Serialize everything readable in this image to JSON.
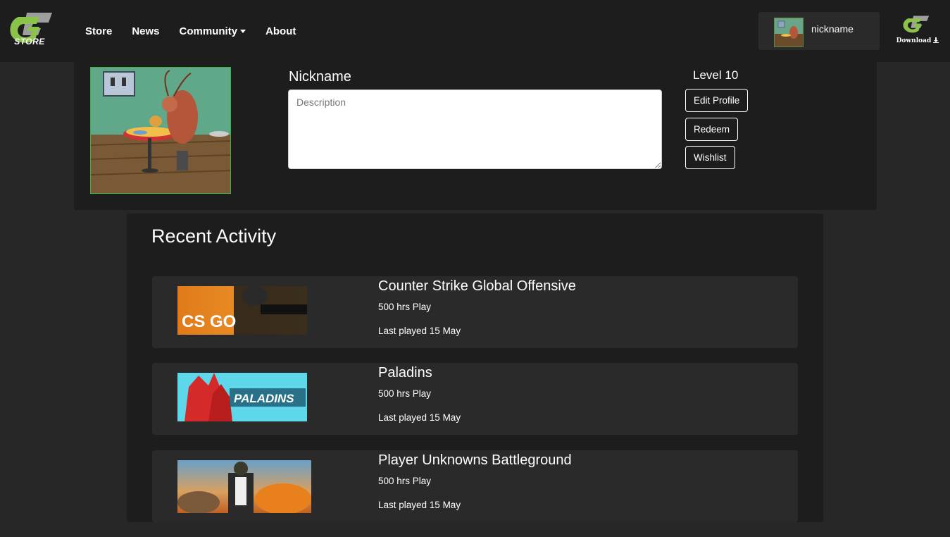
{
  "brand": {
    "logo_text": "STORE",
    "accent_color": "#8bc34a"
  },
  "nav": {
    "links": [
      "Store",
      "News",
      "Community",
      "About"
    ]
  },
  "user": {
    "nickname": "nickname"
  },
  "download": {
    "label": "Download",
    "icon": "download-icon"
  },
  "profile": {
    "name": "Nickname",
    "description_placeholder": "Description",
    "level": "Level 10",
    "buttons": {
      "edit": "Edit Profile",
      "redeem": "Redeem",
      "wishlist": "Wishlist"
    }
  },
  "activity": {
    "title": "Recent Activity",
    "games": [
      {
        "name": "Counter Strike Global Offensive",
        "hours": "500 hrs Play",
        "last_played": "Last played 15 May",
        "banner_text": "CS GO"
      },
      {
        "name": "Paladins",
        "hours": "500 hrs Play",
        "last_played": "Last played 15 May",
        "banner_text": "PALADINS"
      },
      {
        "name": "Player Unknowns Battleground",
        "hours": "500 hrs Play",
        "last_played": "Last played 15 May"
      }
    ]
  }
}
